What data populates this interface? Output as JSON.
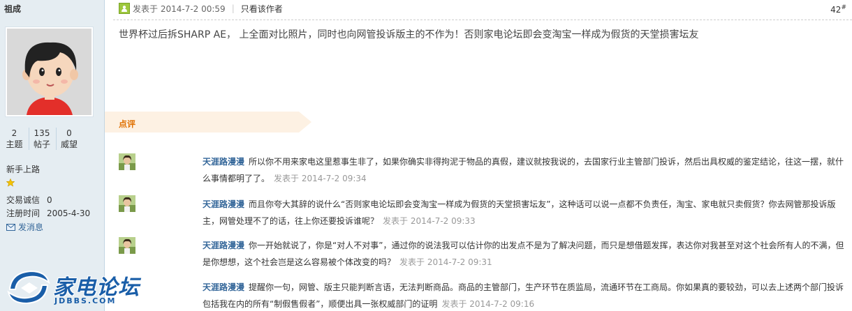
{
  "author": {
    "name": "祖成",
    "stats": [
      {
        "value": "2",
        "label": "主题"
      },
      {
        "value": "135",
        "label": "帖子"
      },
      {
        "value": "0",
        "label": "威望"
      }
    ],
    "rank": "新手上路",
    "credit_label": "交易诚信",
    "credit_value": "0",
    "reg_label": "注册时间",
    "reg_value": "2005-4-30",
    "pm_label": "发消息"
  },
  "post": {
    "posted_at": "发表于 2014-7-2 00:59",
    "author_only": "只看该作者",
    "floor": "42",
    "floor_mark": "#",
    "content": "世界杯过后拆SHARP AE， 上全面对比照片，同时也向网管投诉版主的不作为！否则家电论坛即会变淘宝一样成为假货的天堂损害坛友"
  },
  "comments_label": "点评",
  "comments": [
    {
      "author": "天涯路漫漫",
      "text": "所以你不用来家电这里惹事生非了，如果你确实非得拘泥于物品的真假，建议就按我说的，去国家行业主管部门投诉，然后出具权威的鉴定结论，往这一摆，就什么事情都明了了。",
      "time": "发表于 2014-7-2 09:34"
    },
    {
      "author": "天涯路漫漫",
      "text": "而且你夸大其辞的说什么“否则家电论坛即会变淘宝一样成为假货的天堂损害坛友”，这种话可以说一点都不负责任，淘宝、家电就只卖假货？你去网管那投诉版主，网管处理不了的话，往上你还要投诉谁呢？",
      "time": "发表于 2014-7-2 09:33"
    },
    {
      "author": "天涯路漫漫",
      "text": "你一开始就说了，你是“对人不对事”，通过你的说法我可以估计你的出发点不是为了解决问题，而只是想借题发挥，表达你对我甚至对这个社会所有人的不满，但是你想想，这个社会岂是这么容易被个体改变的吗？",
      "time": "发表于 2014-7-2 09:31"
    },
    {
      "author": "天涯路漫漫",
      "text": "提醒你一句，网管、版主只能判断言语，无法判断商品。商品的主管部门，生产环节在质监局，流通环节在工商局。你如果真的要较劲，可以去上述两个部门投诉包括我在内的所有“制假售假者”，顺便出具一张权威部门的证明",
      "time": "发表于 2014-7-2 09:16"
    }
  ],
  "logo": {
    "cn": "家电论坛",
    "en": "JDBBS.COM"
  }
}
